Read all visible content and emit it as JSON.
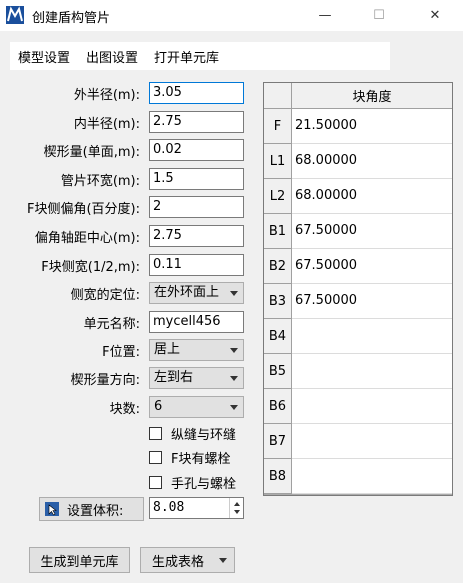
{
  "window": {
    "title": "创建盾构管片",
    "minimize": "—",
    "maximize": "☐",
    "close": "✕"
  },
  "menu": [
    "模型设置",
    "出图设置",
    "打开单元库"
  ],
  "form": {
    "outer_radius": {
      "label": "外半径(m):",
      "value": "3.05"
    },
    "inner_radius": {
      "label": "内半径(m):",
      "value": "2.75"
    },
    "wedge": {
      "label": "楔形量(单面,m):",
      "value": "0.02"
    },
    "ring_width": {
      "label": "管片环宽(m):",
      "value": "1.5"
    },
    "f_angle": {
      "label": "F块侧偏角(百分度):",
      "value": "2"
    },
    "axis_dist": {
      "label": "偏角轴距中心(m):",
      "value": "2.75"
    },
    "f_width": {
      "label": "F块侧宽(1/2,m):",
      "value": "0.11"
    },
    "side_pos": {
      "label": "侧宽的定位:",
      "value": "在外环面上"
    },
    "cell_name": {
      "label": "单元名称:",
      "value": "mycell456"
    },
    "f_pos": {
      "label": "F位置:",
      "value": "居上"
    },
    "wedge_dir": {
      "label": "楔形量方向:",
      "value": "左到右"
    },
    "blocks": {
      "label": "块数:",
      "value": "6"
    }
  },
  "checkboxes": [
    "纵缝与环缝",
    "F块有螺栓",
    "手孔与螺栓"
  ],
  "volume": {
    "label": "设置体积:",
    "value": "8.08"
  },
  "buttons": {
    "generate": "生成到单元库",
    "table": "生成表格"
  },
  "grid": {
    "header": "块角度",
    "rows": [
      {
        "name": "F",
        "value": "21.50000"
      },
      {
        "name": "L1",
        "value": "68.00000"
      },
      {
        "name": "L2",
        "value": "68.00000"
      },
      {
        "name": "B1",
        "value": "67.50000"
      },
      {
        "name": "B2",
        "value": "67.50000"
      },
      {
        "name": "B3",
        "value": "67.50000"
      },
      {
        "name": "B4",
        "value": ""
      },
      {
        "name": "B5",
        "value": ""
      },
      {
        "name": "B6",
        "value": ""
      },
      {
        "name": "B7",
        "value": ""
      },
      {
        "name": "B8",
        "value": ""
      }
    ]
  }
}
